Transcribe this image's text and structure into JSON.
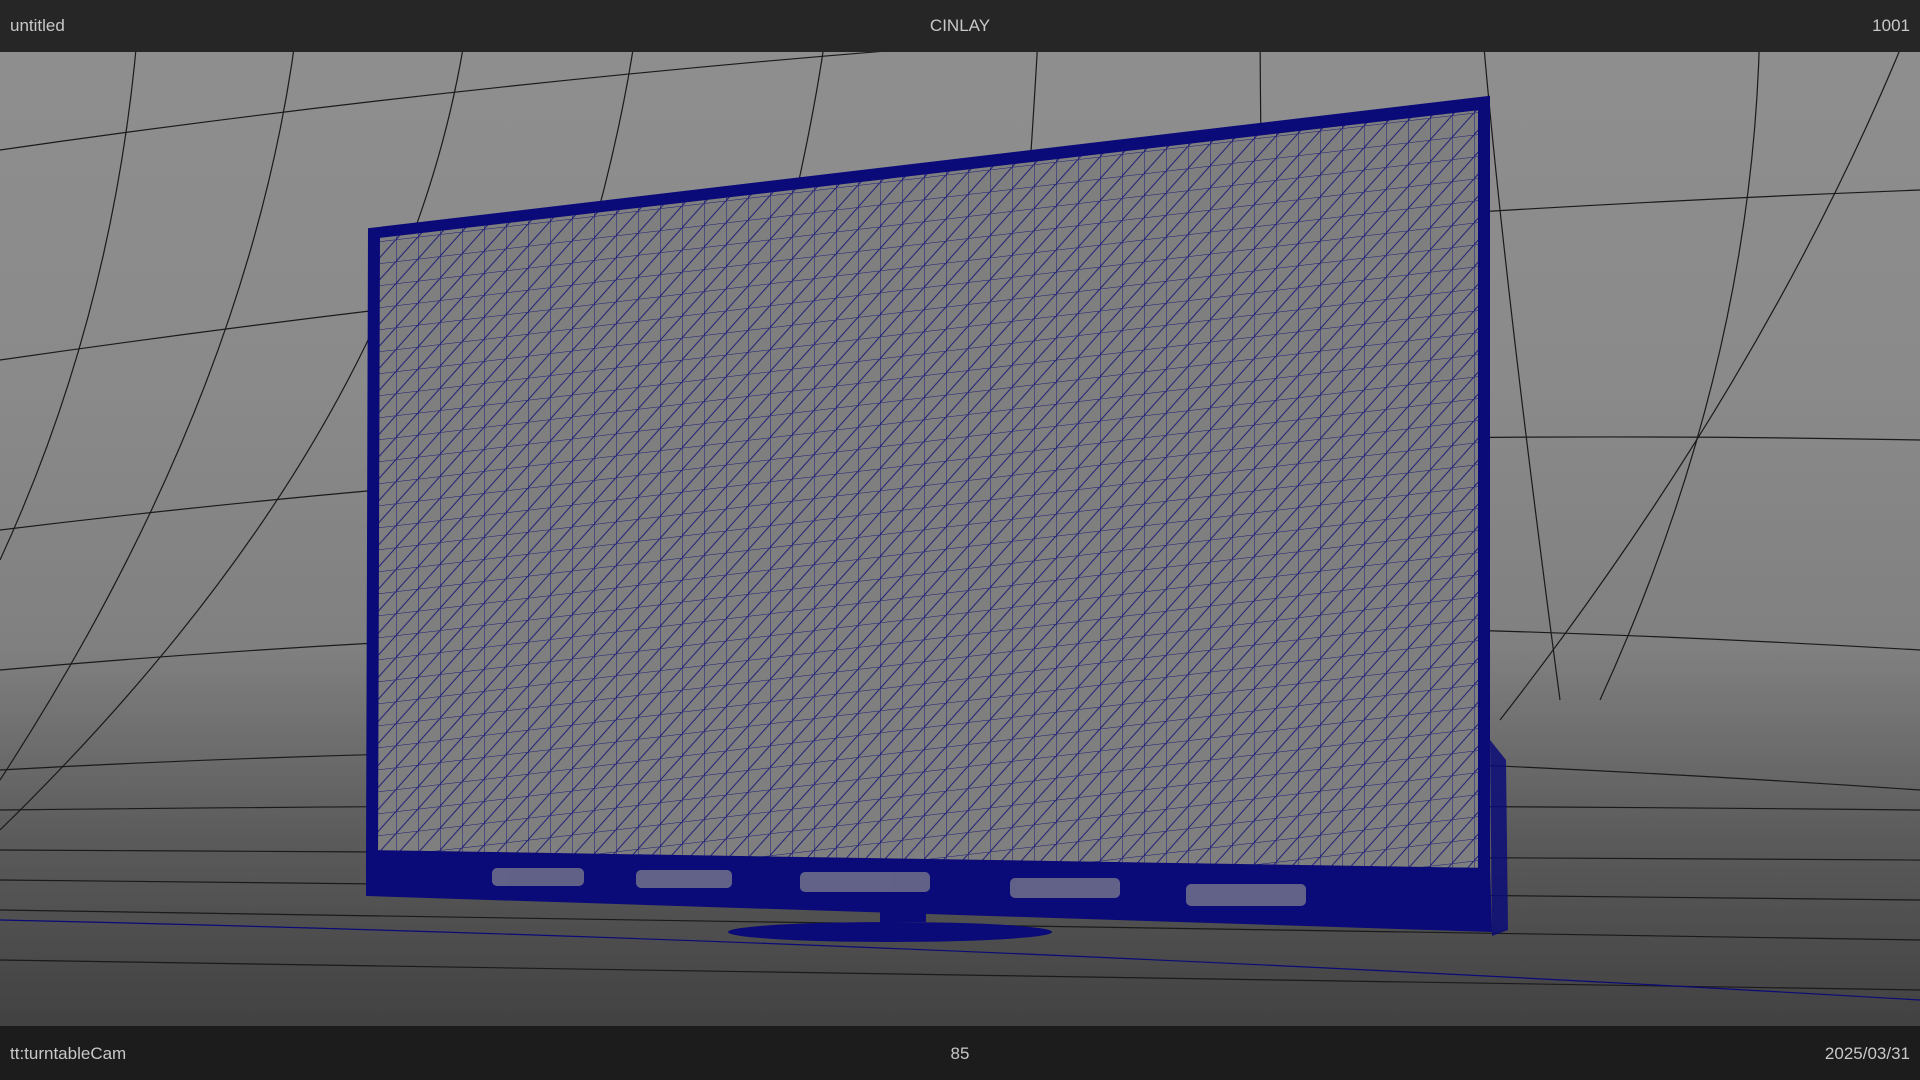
{
  "window": {
    "scene_name": "untitled",
    "title": "CINLAY",
    "title_small": "",
    "frame_top": "1001"
  },
  "footer": {
    "camera": "tt:turntableCam",
    "frame": "85",
    "date": "2025/03/31"
  },
  "colors": {
    "wireframe": "#0a0a78",
    "grid_line": "#1a1a1a",
    "hud_text": "#c8c8c8",
    "hud_small_green": "#2e9a3a"
  },
  "icons": []
}
